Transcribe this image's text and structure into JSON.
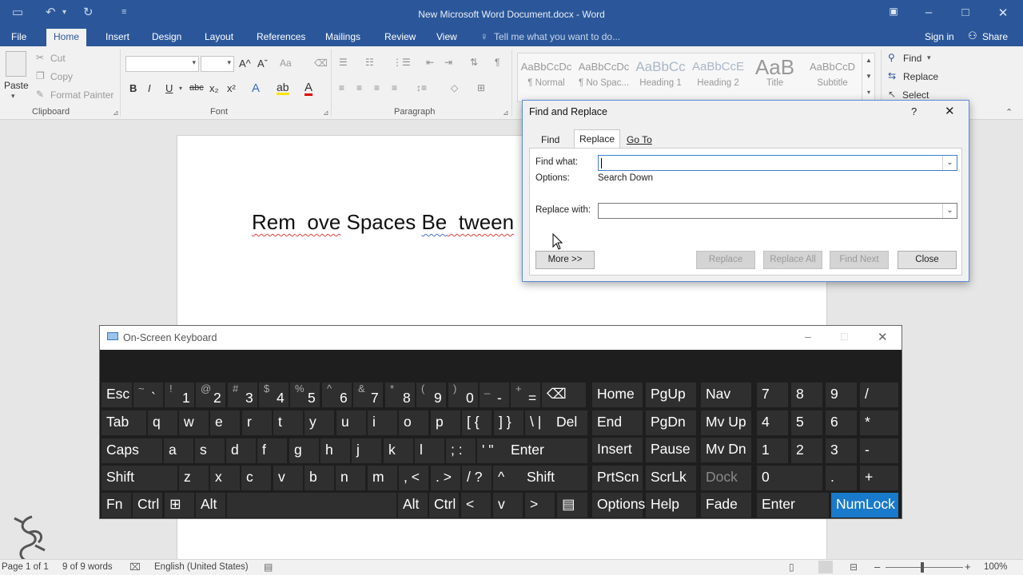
{
  "title_bar": {
    "doc_title": "New Microsoft Word Document.docx - Word",
    "signin": "Sign in",
    "share": "Share"
  },
  "ribbon_tabs": [
    "File",
    "Home",
    "Insert",
    "Design",
    "Layout",
    "References",
    "Mailings",
    "Review",
    "View"
  ],
  "tell_me": "Tell me what you want to do...",
  "clipboard": {
    "paste": "Paste",
    "cut": "Cut",
    "copy": "Copy",
    "format_painter": "Format Painter",
    "label": "Clipboard"
  },
  "font": {
    "label": "Font",
    "bold": "B",
    "italic": "I",
    "underline": "U",
    "strike": "abc",
    "sub": "x₂",
    "sup": "x²",
    "grow": "A^",
    "shrink": "Aˇ",
    "case": "Aa"
  },
  "paragraph": {
    "label": "Paragraph"
  },
  "styles": [
    {
      "preview": "AaBbCcDc",
      "name": "¶ Normal"
    },
    {
      "preview": "AaBbCcDc",
      "name": "¶ No Spac..."
    },
    {
      "preview": "AaBbCc",
      "name": "Heading 1"
    },
    {
      "preview": "AaBbCcE",
      "name": "Heading 2"
    },
    {
      "preview": "AaB",
      "name": "Title"
    },
    {
      "preview": "AaBbCcD",
      "name": "Subtitle"
    }
  ],
  "editing": {
    "find": "Find",
    "replace": "Replace",
    "select": "Select"
  },
  "document": {
    "seg1": "Rem",
    "seg2": "  ove",
    "seg3": " Spaces ",
    "seg4": "Be",
    "seg5": "  tween"
  },
  "status": {
    "page": "Page 1 of 1",
    "words": "9 of 9 words",
    "language": "English (United States)",
    "zoom": "100%"
  },
  "dialog": {
    "title": "Find and Replace",
    "help": "?",
    "tabs": [
      "Find",
      "Replace",
      "Go To"
    ],
    "find_what_label": "Find what:",
    "find_what_value": "",
    "options_label": "Options:",
    "options_value": "Search Down",
    "replace_with_label": "Replace with:",
    "replace_with_value": "",
    "more": "More >>",
    "replace": "Replace",
    "replace_all": "Replace All",
    "find_next": "Find Next",
    "close": "Close"
  },
  "osk": {
    "title": "On-Screen Keyboard",
    "row1": [
      {
        "sup": "",
        "main": "Esc"
      },
      {
        "sup": "~",
        "main": "`"
      },
      {
        "sup": "!",
        "main": "1"
      },
      {
        "sup": "@",
        "main": "2"
      },
      {
        "sup": "#",
        "main": "3"
      },
      {
        "sup": "$",
        "main": "4"
      },
      {
        "sup": "%",
        "main": "5"
      },
      {
        "sup": "^",
        "main": "6"
      },
      {
        "sup": "&",
        "main": "7"
      },
      {
        "sup": "*",
        "main": "8"
      },
      {
        "sup": "(",
        "main": "9"
      },
      {
        "sup": ")",
        "main": "0"
      },
      {
        "sup": "_",
        "main": "-"
      },
      {
        "sup": "+",
        "main": "="
      },
      {
        "sup": "",
        "main": "⌫"
      }
    ],
    "row2": [
      "Tab",
      "q",
      "w",
      "e",
      "r",
      "t",
      "y",
      "u",
      "i",
      "o",
      "p",
      "[ {",
      "] }",
      "\\ |",
      "Del"
    ],
    "row3": [
      "Caps",
      "a",
      "s",
      "d",
      "f",
      "g",
      "h",
      "j",
      "k",
      "l",
      "; :",
      "' \"",
      "Enter"
    ],
    "row4": [
      "Shift",
      "z",
      "x",
      "c",
      "v",
      "b",
      "n",
      "m",
      ", <",
      ". >",
      "/ ?",
      "^",
      "Shift"
    ],
    "row5": [
      "Fn",
      "Ctrl",
      "⊞",
      "Alt",
      "",
      "Alt",
      "Ctrl",
      "<",
      "v",
      ">",
      "▤"
    ],
    "nav": [
      "Home",
      "PgUp",
      "Nav",
      "End",
      "PgDn",
      "Mv Up",
      "Insert",
      "Pause",
      "Mv Dn",
      "PrtScn",
      "ScrLk",
      "Dock",
      "Options",
      "Help",
      "Fade"
    ],
    "numpad": [
      "7",
      "8",
      "9",
      "/",
      "4",
      "5",
      "6",
      "*",
      "1",
      "2",
      "3",
      "-",
      "0",
      ".",
      "+",
      "Enter",
      "NumLock"
    ]
  }
}
